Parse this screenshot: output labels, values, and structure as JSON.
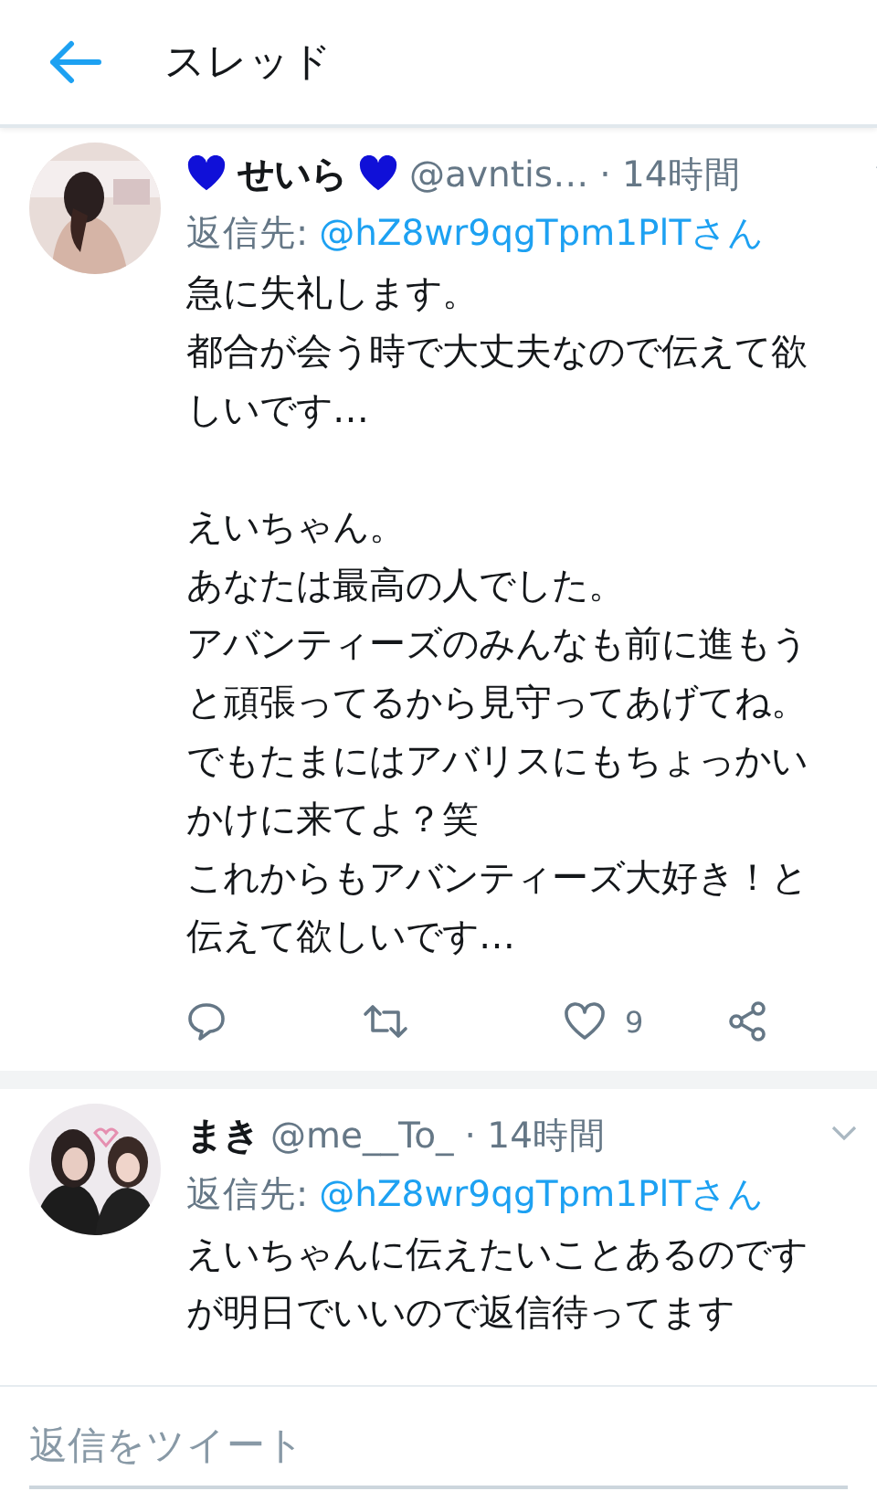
{
  "header": {
    "title": "スレッド"
  },
  "tweets": [
    {
      "name": "せいら",
      "hearts": true,
      "handle": "@avntis…",
      "time": "· 14時間",
      "reply_label": "返信先:",
      "reply_to": "@hZ8wr9qgTpm1PlTさん",
      "body": [
        [
          "急に失礼します。",
          "都合が会う時で大丈夫なので伝えて欲しいです…"
        ],
        [
          "えいちゃん。",
          "あなたは最高の人でした。",
          "アバンティーズのみんなも前に進もうと頑張ってるから見守ってあげてね。",
          "でもたまにはアバリスにもちょっかいかけに来てよ？笑",
          "これからもアバンティーズ大好き！と伝えて欲しいです…"
        ]
      ],
      "likes": "9",
      "actions": true
    },
    {
      "name": "まき",
      "hearts": false,
      "handle": "@me__To_",
      "time": "· 14時間",
      "reply_label": "返信先:",
      "reply_to": "@hZ8wr9qgTpm1PlTさん",
      "body": [
        [
          "えいちゃんに伝えたいことあるのですが明日でいいので返信待ってます"
        ]
      ],
      "actions": false
    }
  ],
  "reply_box": {
    "placeholder": "返信をツイート"
  }
}
